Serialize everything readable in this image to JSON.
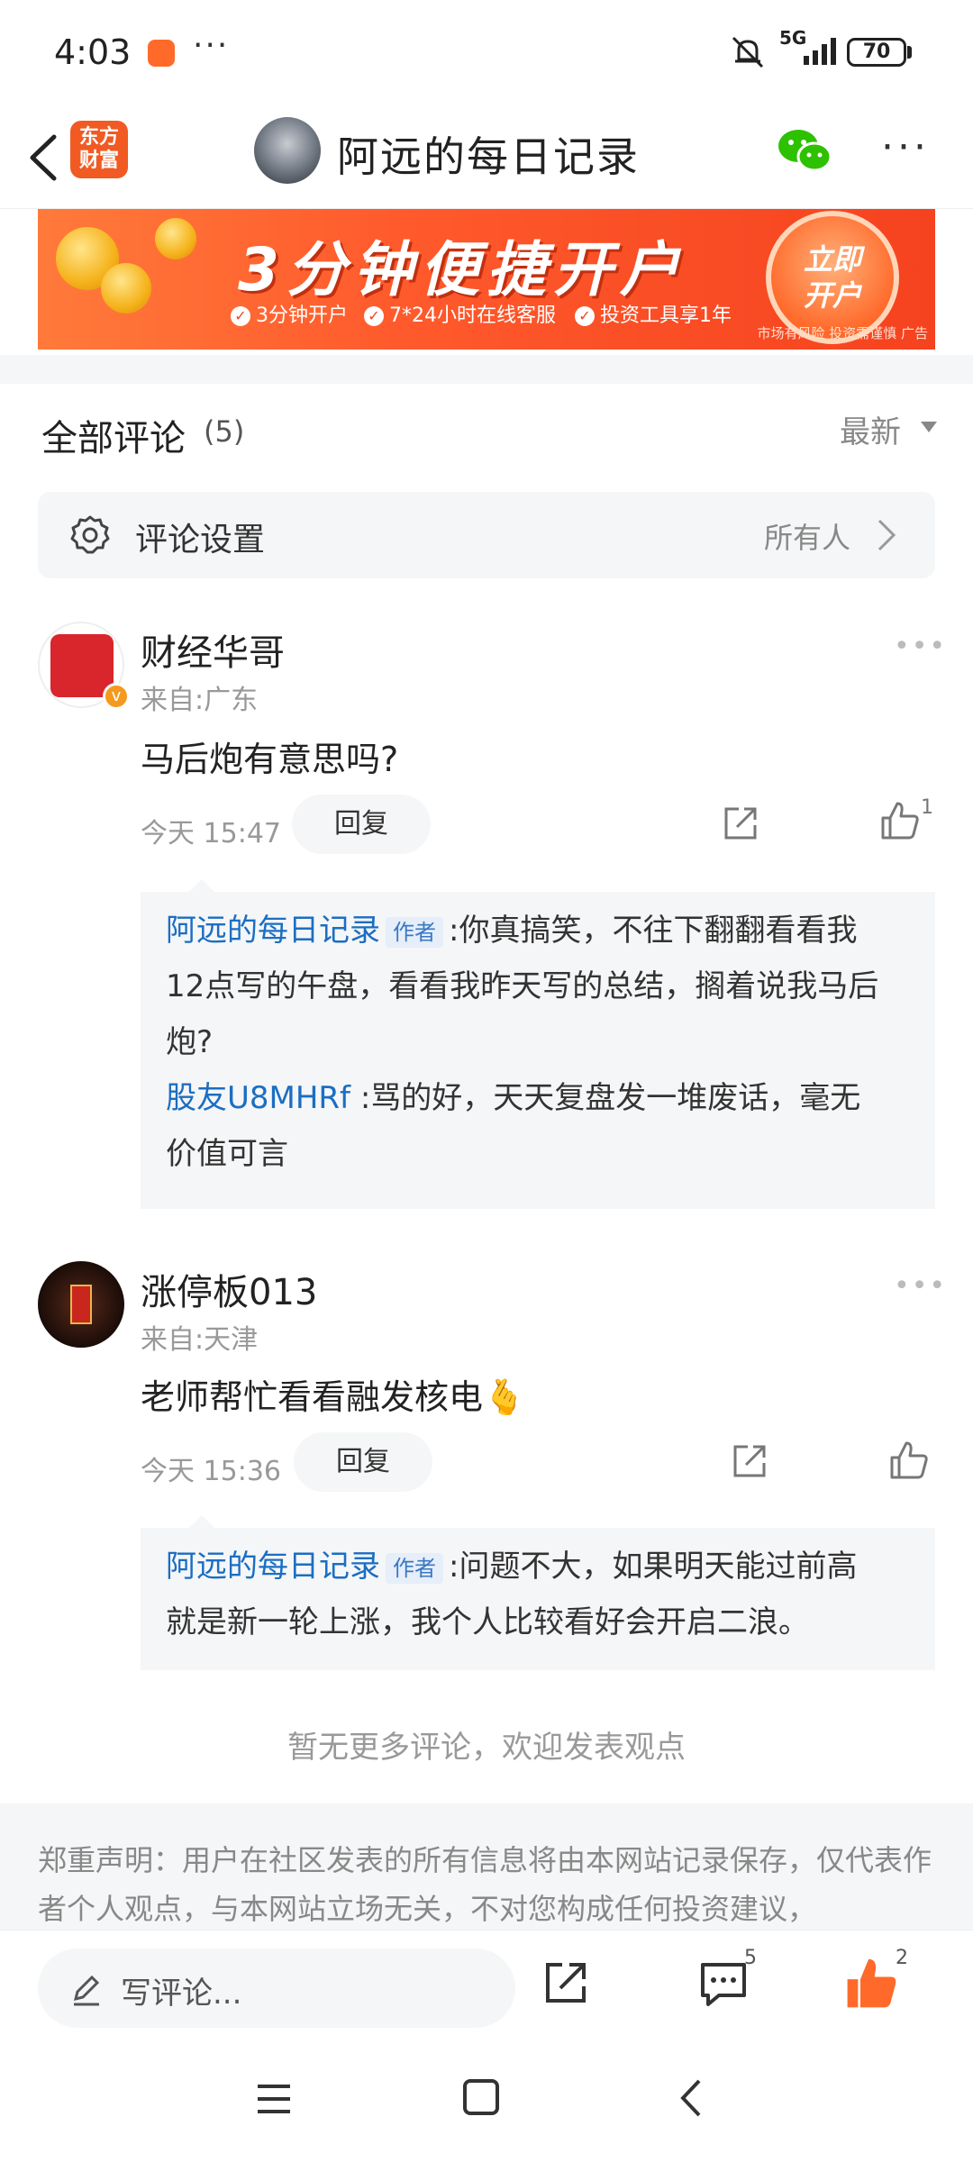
{
  "status_bar": {
    "time": "4:03",
    "more": "···",
    "network": "5G",
    "battery": "70"
  },
  "nav": {
    "logo_text": "东方\n财富",
    "title": "阿远的每日记录",
    "more": "···"
  },
  "ad": {
    "headline": "3分钟便捷开户",
    "features": [
      "3分钟开户",
      "7*24小时在线客服",
      "投资工具享1年"
    ],
    "cta": "立即\n开户",
    "risk": "市场有风险 投资需谨慎 广告"
  },
  "comments_header": {
    "title": "全部评论",
    "count": "(5)",
    "sort": "最新"
  },
  "settings": {
    "label": "评论设置",
    "value": "所有人"
  },
  "comments": [
    {
      "name": "财经华哥",
      "from": "来自:广东",
      "text": "马后炮有意思吗?",
      "time": "今天 15:47",
      "reply_label": "回复",
      "likes": "1",
      "replies": [
        {
          "author": "阿远的每日记录",
          "tag": "作者",
          "line1": ":你真搞笑，不往下翻翻看看我",
          "line2": "12点写的午盘，看看我昨天写的总结，搁着说我马后",
          "line3": "炮?"
        },
        {
          "author": "股友U8MHRf",
          "line1": ":骂的好，天天复盘发一堆废话，毫无",
          "line2": "价值可言"
        }
      ]
    },
    {
      "name": "涨停板013",
      "from": "来自:天津",
      "text": "老师帮忙看看融发核电🫰",
      "time": "今天 15:36",
      "reply_label": "回复",
      "replies": [
        {
          "author": "阿远的每日记录",
          "tag": "作者",
          "line1": ":问题不大，如果明天能过前高",
          "line2": "就是新一轮上涨，我个人比较看好会开启二浪。"
        }
      ]
    }
  ],
  "no_more": "暂无更多评论，欢迎发表观点",
  "disclaimer": "郑重声明：用户在社区发表的所有信息将由本网站记录保存，仅代表作者个人观点，与本网站立场无关，不对您构成任何投资建议，",
  "bottom_bar": {
    "input_placeholder": "写评论...",
    "comment_count": "5",
    "like_count": "2"
  },
  "colors": {
    "accent": "#f15a22",
    "link": "#1b6ec2",
    "like": "#ff6a2b"
  }
}
